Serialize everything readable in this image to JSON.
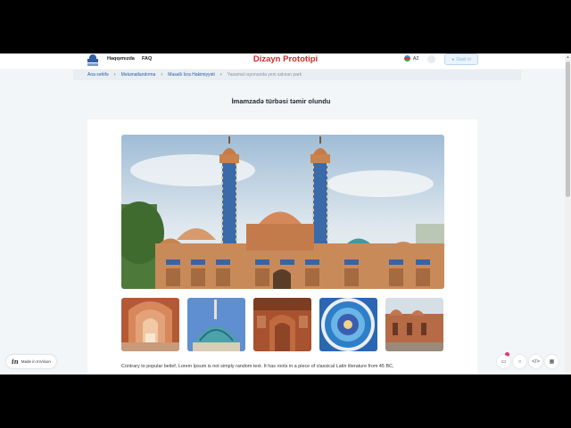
{
  "header": {
    "nav": [
      "Haqqımızda",
      "FAQ"
    ],
    "title": "Dizayn Prototipi",
    "lang": "AZ",
    "login": "Daxil ol"
  },
  "breadcrumb": [
    "Ana səhifə",
    "Məlumatlandırma",
    "Masallı İcra Hakimiyyəti",
    "Yasamal rayonunda yeni salınan park"
  ],
  "page": {
    "heading": "İmamzadə türbəsi təmir olundu",
    "paragraph": "Contrary to popular belief, Lorem Ipsum is not simply random text. It has roots in a piece of classical Latin literature from 45 BC,"
  },
  "gallery": {
    "hero": "mosque-with-twin-minarets",
    "thumbs": [
      "arched-corridor",
      "turquoise-dome",
      "brick-interior",
      "blue-ceiling-mosaic",
      "brick-building-exterior"
    ]
  },
  "footer": {
    "badge": "Made in InVision",
    "badge_logo": "in"
  },
  "colors": {
    "brand": "#c4312d",
    "link": "#2a5ea8",
    "accent": "#2f5fa7"
  }
}
